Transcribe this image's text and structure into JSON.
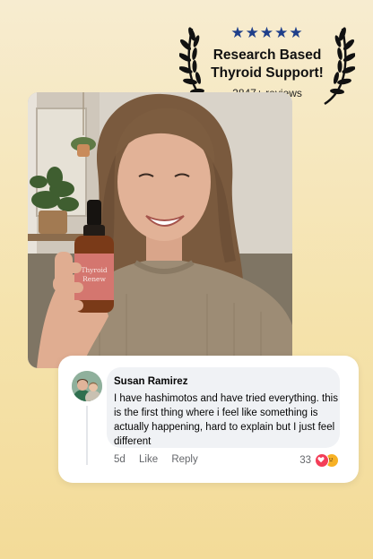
{
  "badge": {
    "stars": "★★★★★",
    "title_line1": "Research Based",
    "title_line2": "Thyroid Support!",
    "reviews": "2847+ reviews"
  },
  "product": {
    "label_line1": "Thyroid",
    "label_line2": "Renew"
  },
  "comment": {
    "author": "Susan Ramirez",
    "text": "I have hashimotos and have tried everything. this is the first thing where i feel like something is actually happening, hard to explain but I just feel different",
    "time": "5d",
    "like_label": "Like",
    "reply_label": "Reply",
    "reaction_count": "33",
    "reactions": [
      "heart-icon",
      "care-icon"
    ]
  },
  "colors": {
    "background_top": "#f7ecd0",
    "background_bottom": "#f3db98",
    "stars": "#1f3f8a",
    "bottle_label": "#d4766f"
  }
}
